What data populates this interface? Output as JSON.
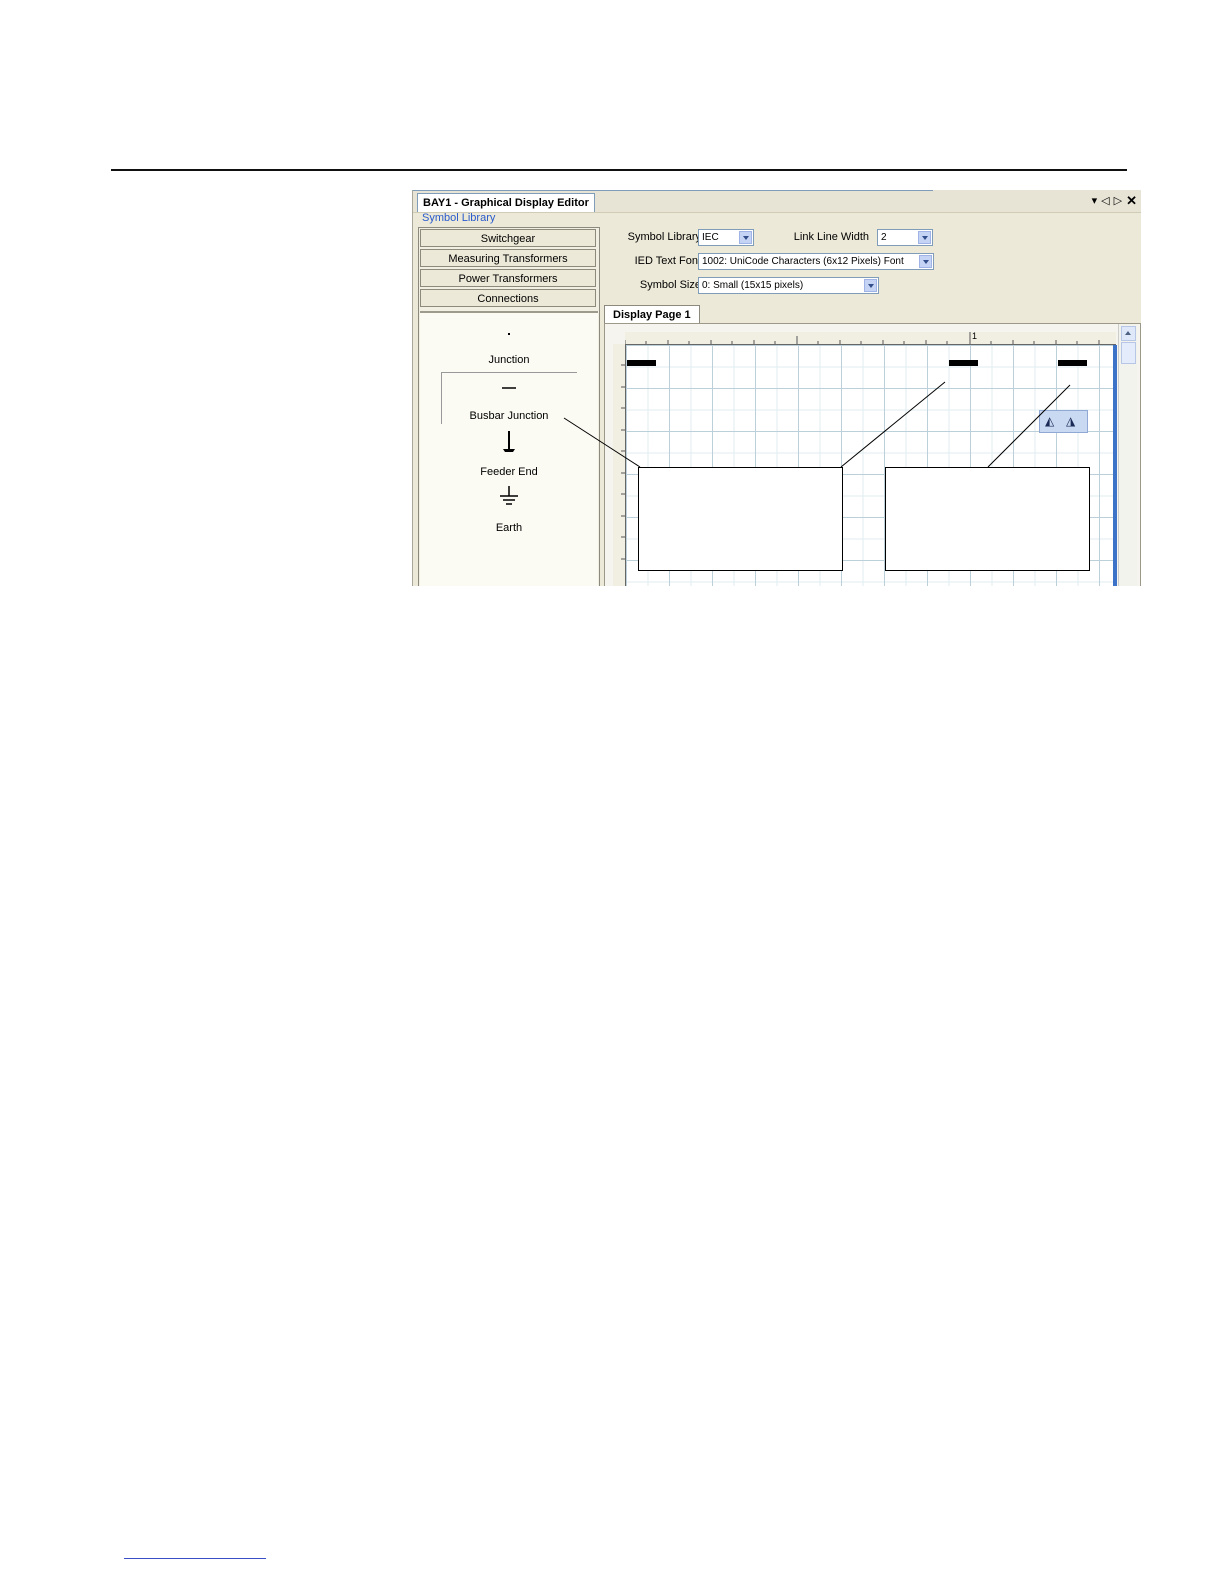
{
  "editor": {
    "tab_title": "BAY1 - Graphical Display Editor",
    "window_buttons": [
      "▾",
      "◁",
      "▷",
      "✕"
    ],
    "symbol_library_header": "Symbol Library",
    "categories": [
      "Switchgear",
      "Measuring Transformers",
      "Power Transformers",
      "Connections"
    ],
    "symbols": [
      {
        "label": "Junction",
        "icon": "junction-dot-icon"
      },
      {
        "label": "Busbar Junction",
        "icon": "busbar-junction-icon"
      },
      {
        "label": "Feeder End",
        "icon": "feeder-end-arrow-icon"
      },
      {
        "label": "Earth",
        "icon": "earth-ground-icon"
      }
    ],
    "settings": {
      "symbol_library_label": "Symbol Library",
      "symbol_library_value": "IEC",
      "link_line_width_label": "Link Line Width",
      "link_line_width_value": "2",
      "ied_text_font_label": "IED Text Font",
      "ied_text_font_value": "1002: UniCode Characters (6x12 Pixels) Font",
      "symbol_size_label": "Symbol Size",
      "symbol_size_value": "0: Small (15x15 pixels)"
    },
    "page_tab": "Display Page 1",
    "ruler_mark": "1",
    "float_toolbar_icons": [
      "flip-horizontal-icon",
      "flip-vertical-icon"
    ]
  }
}
